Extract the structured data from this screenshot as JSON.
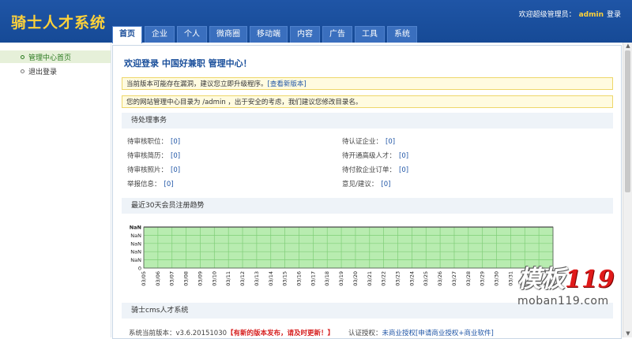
{
  "header": {
    "logo": "骑士人才系统",
    "greeting": "欢迎超级管理员：",
    "username": "admin",
    "logout": "登录"
  },
  "tabs": [
    "首页",
    "企业",
    "个人",
    "微商圈",
    "移动端",
    "内容",
    "广告",
    "工具",
    "系统"
  ],
  "sidebar": {
    "items": [
      {
        "label": "管理中心首页"
      },
      {
        "label": "退出登录"
      }
    ]
  },
  "main": {
    "welcome": "欢迎登录 中国好兼职 管理中心！",
    "notice1": {
      "text": "当前版本可能存在漏洞，建议您立即升级程序。",
      "link": "[查看新版本]"
    },
    "notice2": {
      "text": "您的网站管理中心目录为 /admin ，出于安全的考虑，我们建议您修改目录名。"
    },
    "pending": {
      "title": "待处理事务",
      "left": [
        {
          "label": "待审核职位：",
          "count": "[0]"
        },
        {
          "label": "待审核简历：",
          "count": "[0]"
        },
        {
          "label": "待审核照片：",
          "count": "[0]"
        },
        {
          "label": "举报信息：",
          "count": "[0]"
        }
      ],
      "right": [
        {
          "label": "待认证企业：",
          "count": "[0]"
        },
        {
          "label": "待开通高级人才：",
          "count": "[0]"
        },
        {
          "label": "待付款企业订单：",
          "count": "[0]"
        },
        {
          "label": "意见/建议：",
          "count": "[0]"
        }
      ]
    },
    "trend_title": "最近30天会员注册趋势",
    "system": {
      "title": "骑士cms人才系统",
      "version_label": "系统当前版本：",
      "version": "v3.6.20151030",
      "update_note": "【有新的版本发布，请及时更新！】",
      "auth_label": "认证授权：",
      "auth_value": "未商业授权[申请商业授权+商业软件]"
    }
  },
  "chart_data": {
    "type": "area",
    "title": "",
    "x": [
      "03/05",
      "03/06",
      "03/07",
      "03/08",
      "03/09",
      "03/10",
      "03/11",
      "03/12",
      "03/13",
      "03/14",
      "03/15",
      "03/16",
      "03/17",
      "03/18",
      "03/19",
      "03/20",
      "03/21",
      "03/22",
      "03/23",
      "03/24",
      "03/25",
      "03/26",
      "03/27",
      "03/28",
      "03/29",
      "03/30",
      "03/31",
      "04/01",
      "04/02",
      "04/03"
    ],
    "y_tick_labels": [
      "NaN",
      "NaN",
      "NaN",
      "NaN",
      "NaN",
      "0"
    ],
    "values": [],
    "grid": true,
    "colors": {
      "fill": "#b8ecb0",
      "grid": "#7fce77",
      "line": "#333333"
    }
  },
  "watermark": {
    "cn": "模板",
    "num": "119",
    "url": "moban119.com"
  }
}
